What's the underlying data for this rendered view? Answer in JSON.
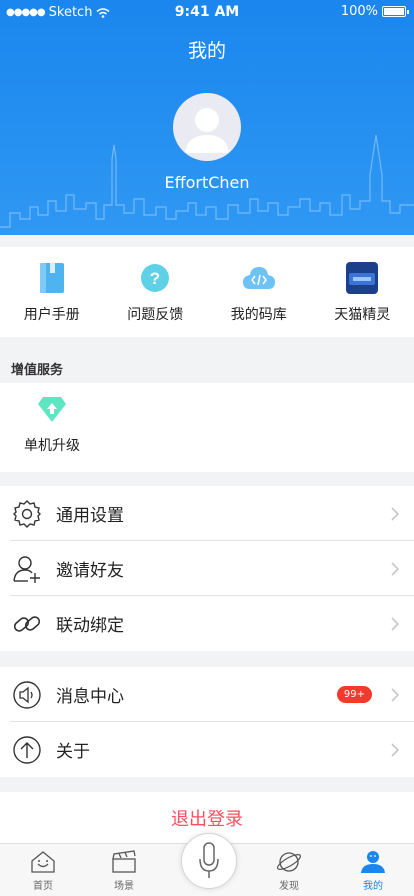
{
  "statusbar": {
    "carrier": "Sketch",
    "time": "9:41 AM",
    "battery": "100%"
  },
  "header": {
    "title": "我的",
    "username": "EffortChen"
  },
  "tools": [
    {
      "label": "用户手册",
      "icon": "manual-book-icon"
    },
    {
      "label": "问题反馈",
      "icon": "question-feedback-icon"
    },
    {
      "label": "我的码库",
      "icon": "code-cloud-icon"
    },
    {
      "label": "天猫精灵",
      "icon": "tmall-genie-icon"
    }
  ],
  "value_services": {
    "title": "增值服务",
    "items": [
      {
        "label": "单机升级",
        "icon": "diamond-upgrade-icon"
      }
    ]
  },
  "settings_group": [
    {
      "label": "通用设置",
      "icon": "gear-icon"
    },
    {
      "label": "邀请好友",
      "icon": "add-user-icon"
    },
    {
      "label": "联动绑定",
      "icon": "link-icon"
    }
  ],
  "info_group": [
    {
      "label": "消息中心",
      "icon": "speaker-icon",
      "badge": "99+"
    },
    {
      "label": "关于",
      "icon": "up-arrow-circle-icon"
    }
  ],
  "logout_label": "退出登录",
  "tabbar": [
    {
      "label": "首页",
      "icon": "home-icon"
    },
    {
      "label": "场景",
      "icon": "clapper-icon"
    },
    {
      "label": "",
      "icon": "microphone-icon"
    },
    {
      "label": "发现",
      "icon": "planet-icon"
    },
    {
      "label": "我的",
      "icon": "profile-icon"
    }
  ],
  "colors": {
    "primary": "#1a86ee",
    "logout": "#ff4e61",
    "badge": "#f33a2c"
  }
}
